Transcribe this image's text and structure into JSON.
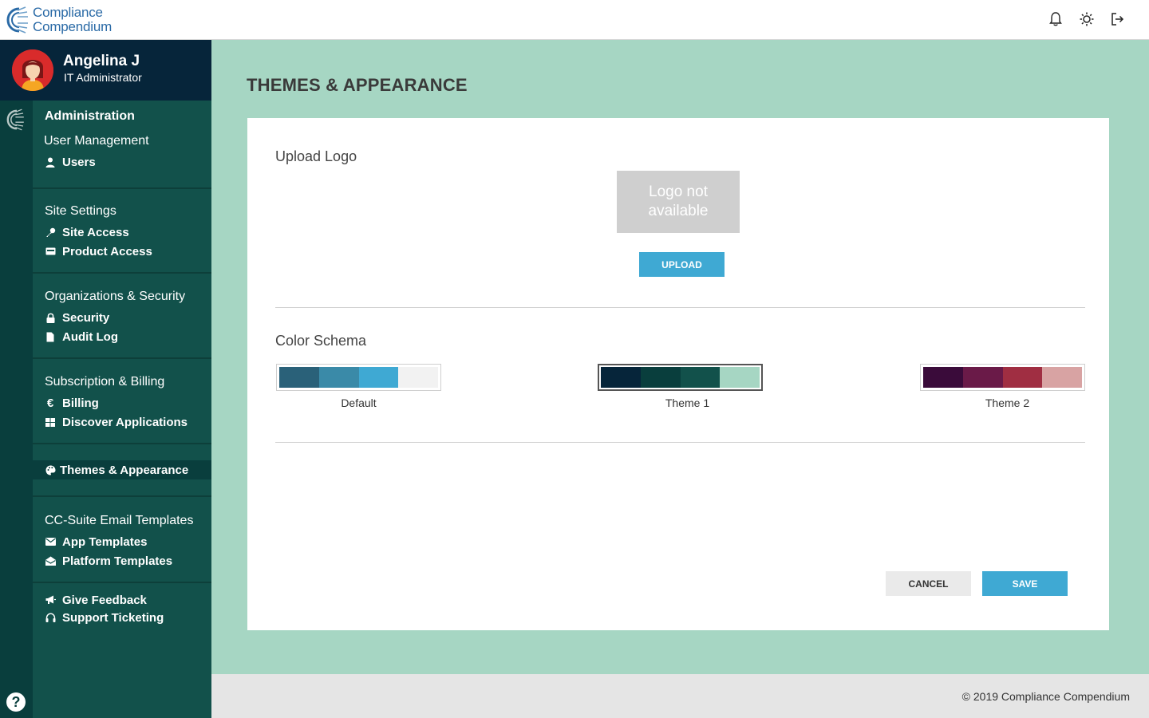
{
  "brand": {
    "line1": "Compliance",
    "line2": "Compendium",
    "color": "#2a6aa6"
  },
  "header_icons": [
    "bell-icon",
    "sun-icon",
    "logout-icon"
  ],
  "user": {
    "name": "Angelina J",
    "role": "IT Administrator"
  },
  "sidebar": {
    "groups": [
      {
        "title": "Administration",
        "subtitle": "User Management",
        "items": [
          {
            "label": "Users",
            "icon": "user-icon"
          }
        ]
      },
      {
        "title": "Site Settings",
        "items": [
          {
            "label": "Site Access",
            "icon": "key-icon"
          },
          {
            "label": "Product Access",
            "icon": "card-icon"
          }
        ]
      },
      {
        "title": "Organizations & Security",
        "items": [
          {
            "label": "Security",
            "icon": "lock-icon"
          },
          {
            "label": "Audit Log",
            "icon": "document-icon"
          }
        ]
      },
      {
        "title": "Subscription & Billing",
        "items": [
          {
            "label": "Billing",
            "icon": "euro-icon"
          },
          {
            "label": "Discover Applications",
            "icon": "grid-icon"
          }
        ]
      },
      {
        "items": [
          {
            "label": "Themes & Appearance",
            "icon": "palette-icon",
            "active": true
          }
        ]
      },
      {
        "title": "CC-Suite Email Templates",
        "items": [
          {
            "label": "App Templates",
            "icon": "envelope-icon"
          },
          {
            "label": "Platform Templates",
            "icon": "envelope-open-icon"
          }
        ]
      },
      {
        "items": [
          {
            "label": "Give Feedback",
            "icon": "megaphone-icon"
          },
          {
            "label": "Support Ticketing",
            "icon": "headset-icon"
          }
        ]
      }
    ],
    "help_label": "?"
  },
  "main": {
    "title": "THEMES & APPEARANCE",
    "upload_section": {
      "title": "Upload Logo",
      "placeholder": "Logo not available",
      "upload_button": "UPLOAD"
    },
    "color_section": {
      "title": "Color Schema",
      "schemes": [
        {
          "name": "Default",
          "colors": [
            "#2a6179",
            "#3a8aa8",
            "#3fa9d3",
            "#f2f2f2"
          ],
          "selected": false
        },
        {
          "name": "Theme 1",
          "colors": [
            "#06253a",
            "#093e3d",
            "#12514b",
            "#a6d6c3"
          ],
          "selected": true
        },
        {
          "name": "Theme 2",
          "colors": [
            "#3a0b3a",
            "#6a1a48",
            "#a02e42",
            "#d8a3a3"
          ],
          "selected": false
        }
      ]
    },
    "cancel_button": "CANCEL",
    "save_button": "SAVE"
  },
  "footer": {
    "copyright": "© 2019 Compliance Compendium"
  }
}
